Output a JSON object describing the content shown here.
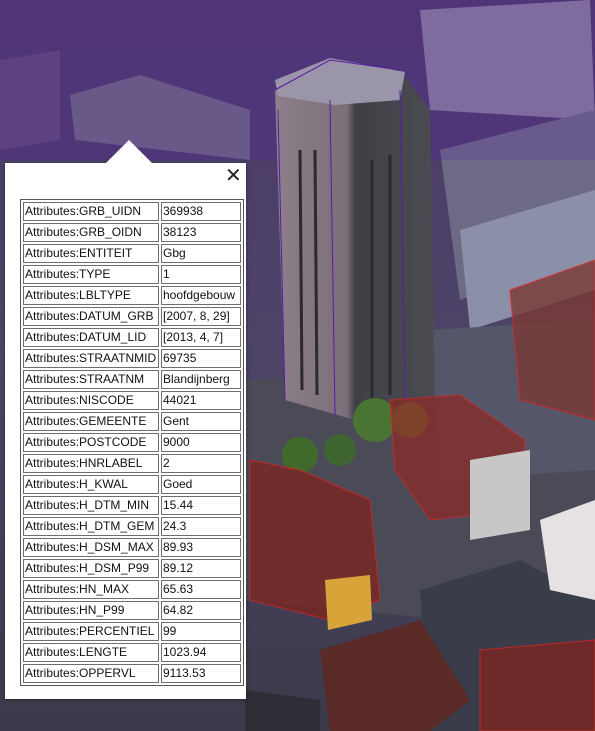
{
  "map": {
    "view": "3D aerial",
    "overlay_colors": {
      "selected_outline": "#5a1aa8",
      "buildings_outline": "#e02020",
      "purple_tint": "#4b2a80"
    }
  },
  "popup": {
    "close_icon": "close-icon",
    "rows": [
      {
        "key": "Attributes:GRB_UIDN",
        "value": "369938"
      },
      {
        "key": "Attributes:GRB_OIDN",
        "value": "38123"
      },
      {
        "key": "Attributes:ENTITEIT",
        "value": "Gbg"
      },
      {
        "key": "Attributes:TYPE",
        "value": "1"
      },
      {
        "key": "Attributes:LBLTYPE",
        "value": "hoofdgebouw"
      },
      {
        "key": "Attributes:DATUM_GRB",
        "value": "[2007, 8, 29]"
      },
      {
        "key": "Attributes:DATUM_LID",
        "value": "[2013, 4, 7]"
      },
      {
        "key": "Attributes:STRAATNMID",
        "value": "69735"
      },
      {
        "key": "Attributes:STRAATNM",
        "value": "Blandijnberg"
      },
      {
        "key": "Attributes:NISCODE",
        "value": "44021"
      },
      {
        "key": "Attributes:GEMEENTE",
        "value": "Gent"
      },
      {
        "key": "Attributes:POSTCODE",
        "value": "9000"
      },
      {
        "key": "Attributes:HNRLABEL",
        "value": "2"
      },
      {
        "key": "Attributes:H_KWAL",
        "value": "Goed"
      },
      {
        "key": "Attributes:H_DTM_MIN",
        "value": "15.44"
      },
      {
        "key": "Attributes:H_DTM_GEM",
        "value": "24.3"
      },
      {
        "key": "Attributes:H_DSM_MAX",
        "value": "89.93"
      },
      {
        "key": "Attributes:H_DSM_P99",
        "value": "89.12"
      },
      {
        "key": "Attributes:HN_MAX",
        "value": "65.63"
      },
      {
        "key": "Attributes:HN_P99",
        "value": "64.82"
      },
      {
        "key": "Attributes:PERCENTIEL",
        "value": "99"
      },
      {
        "key": "Attributes:LENGTE",
        "value": "1023.94"
      },
      {
        "key": "Attributes:OPPERVL",
        "value": "9113.53"
      }
    ]
  }
}
